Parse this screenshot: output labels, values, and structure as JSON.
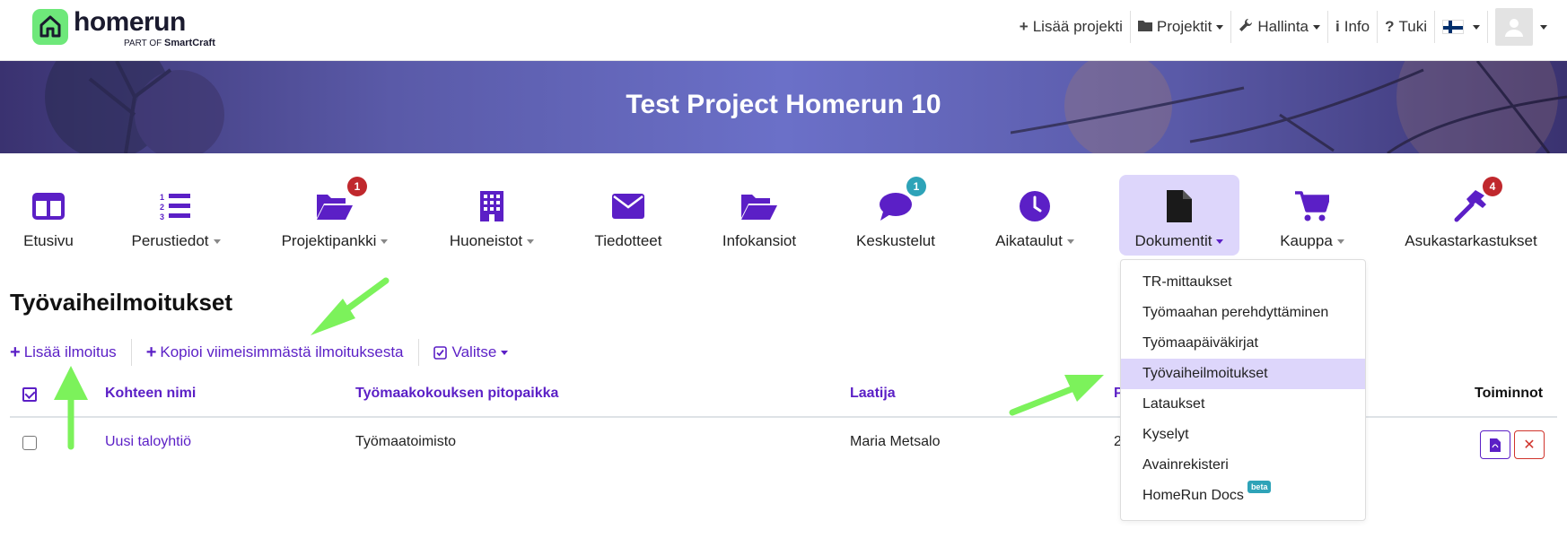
{
  "brand": {
    "word": "homerun",
    "sub_prefix": "PART OF",
    "sub_brand": "SmartCraft"
  },
  "topnav": {
    "add_project": "Lisää projekti",
    "projects": "Projektit",
    "admin": "Hallinta",
    "info": "Info",
    "help": "Tuki"
  },
  "banner": {
    "title": "Test Project Homerun 10"
  },
  "modules": [
    {
      "label": "Etusivu",
      "icon": "layout-icon",
      "dropdown": false
    },
    {
      "label": "Perustiedot",
      "icon": "list-ol-icon",
      "dropdown": true
    },
    {
      "label": "Projektipankki",
      "icon": "folder-open-icon",
      "dropdown": true,
      "badge": "1"
    },
    {
      "label": "Huoneistot",
      "icon": "building-icon",
      "dropdown": true
    },
    {
      "label": "Tiedotteet",
      "icon": "envelope-icon",
      "dropdown": false
    },
    {
      "label": "Infokansiot",
      "icon": "folder-open-icon",
      "dropdown": false
    },
    {
      "label": "Keskustelut",
      "icon": "chat-icon",
      "dropdown": false,
      "badge": "1"
    },
    {
      "label": "Aikataulut",
      "icon": "clock-icon",
      "dropdown": true
    },
    {
      "label": "Dokumentit",
      "icon": "file-icon",
      "dropdown": true
    },
    {
      "label": "Kauppa",
      "icon": "cart-icon",
      "dropdown": true
    },
    {
      "label": "Asukastarkastukset",
      "icon": "hammer-icon",
      "dropdown": false,
      "badge": "4"
    }
  ],
  "dropdown": {
    "items": [
      "TR-mittaukset",
      "Työmaahan perehdyttäminen",
      "Työmaapäiväkirjat",
      "Työvaiheilmoitukset",
      "Lataukset",
      "Kyselyt",
      "Avainrekisteri",
      "HomeRun Docs"
    ],
    "beta_label": "beta",
    "active_index": 3
  },
  "page": {
    "title": "Työvaiheilmoitukset",
    "actions": {
      "add": "Lisää ilmoitus",
      "copy": "Kopioi viimeisimmästä ilmoituksesta",
      "select": "Valitse"
    }
  },
  "table": {
    "headers": {
      "name": "Kohteen nimi",
      "place": "Työmaakokouksen pitopaikka",
      "author": "Laatija",
      "date_partial": "P",
      "actions": "Toiminnot"
    },
    "rows": [
      {
        "name": "Uusi taloyhtiö",
        "place": "Työmaatoimisto",
        "author": "Maria Metsalo",
        "date_partial": "2"
      }
    ]
  },
  "colors": {
    "accent": "#5b1fc6",
    "active_bg": "#ddd6fb",
    "arrow": "#7cf25b",
    "badge_red": "#c0282d",
    "badge_teal": "#2ea3b8"
  }
}
